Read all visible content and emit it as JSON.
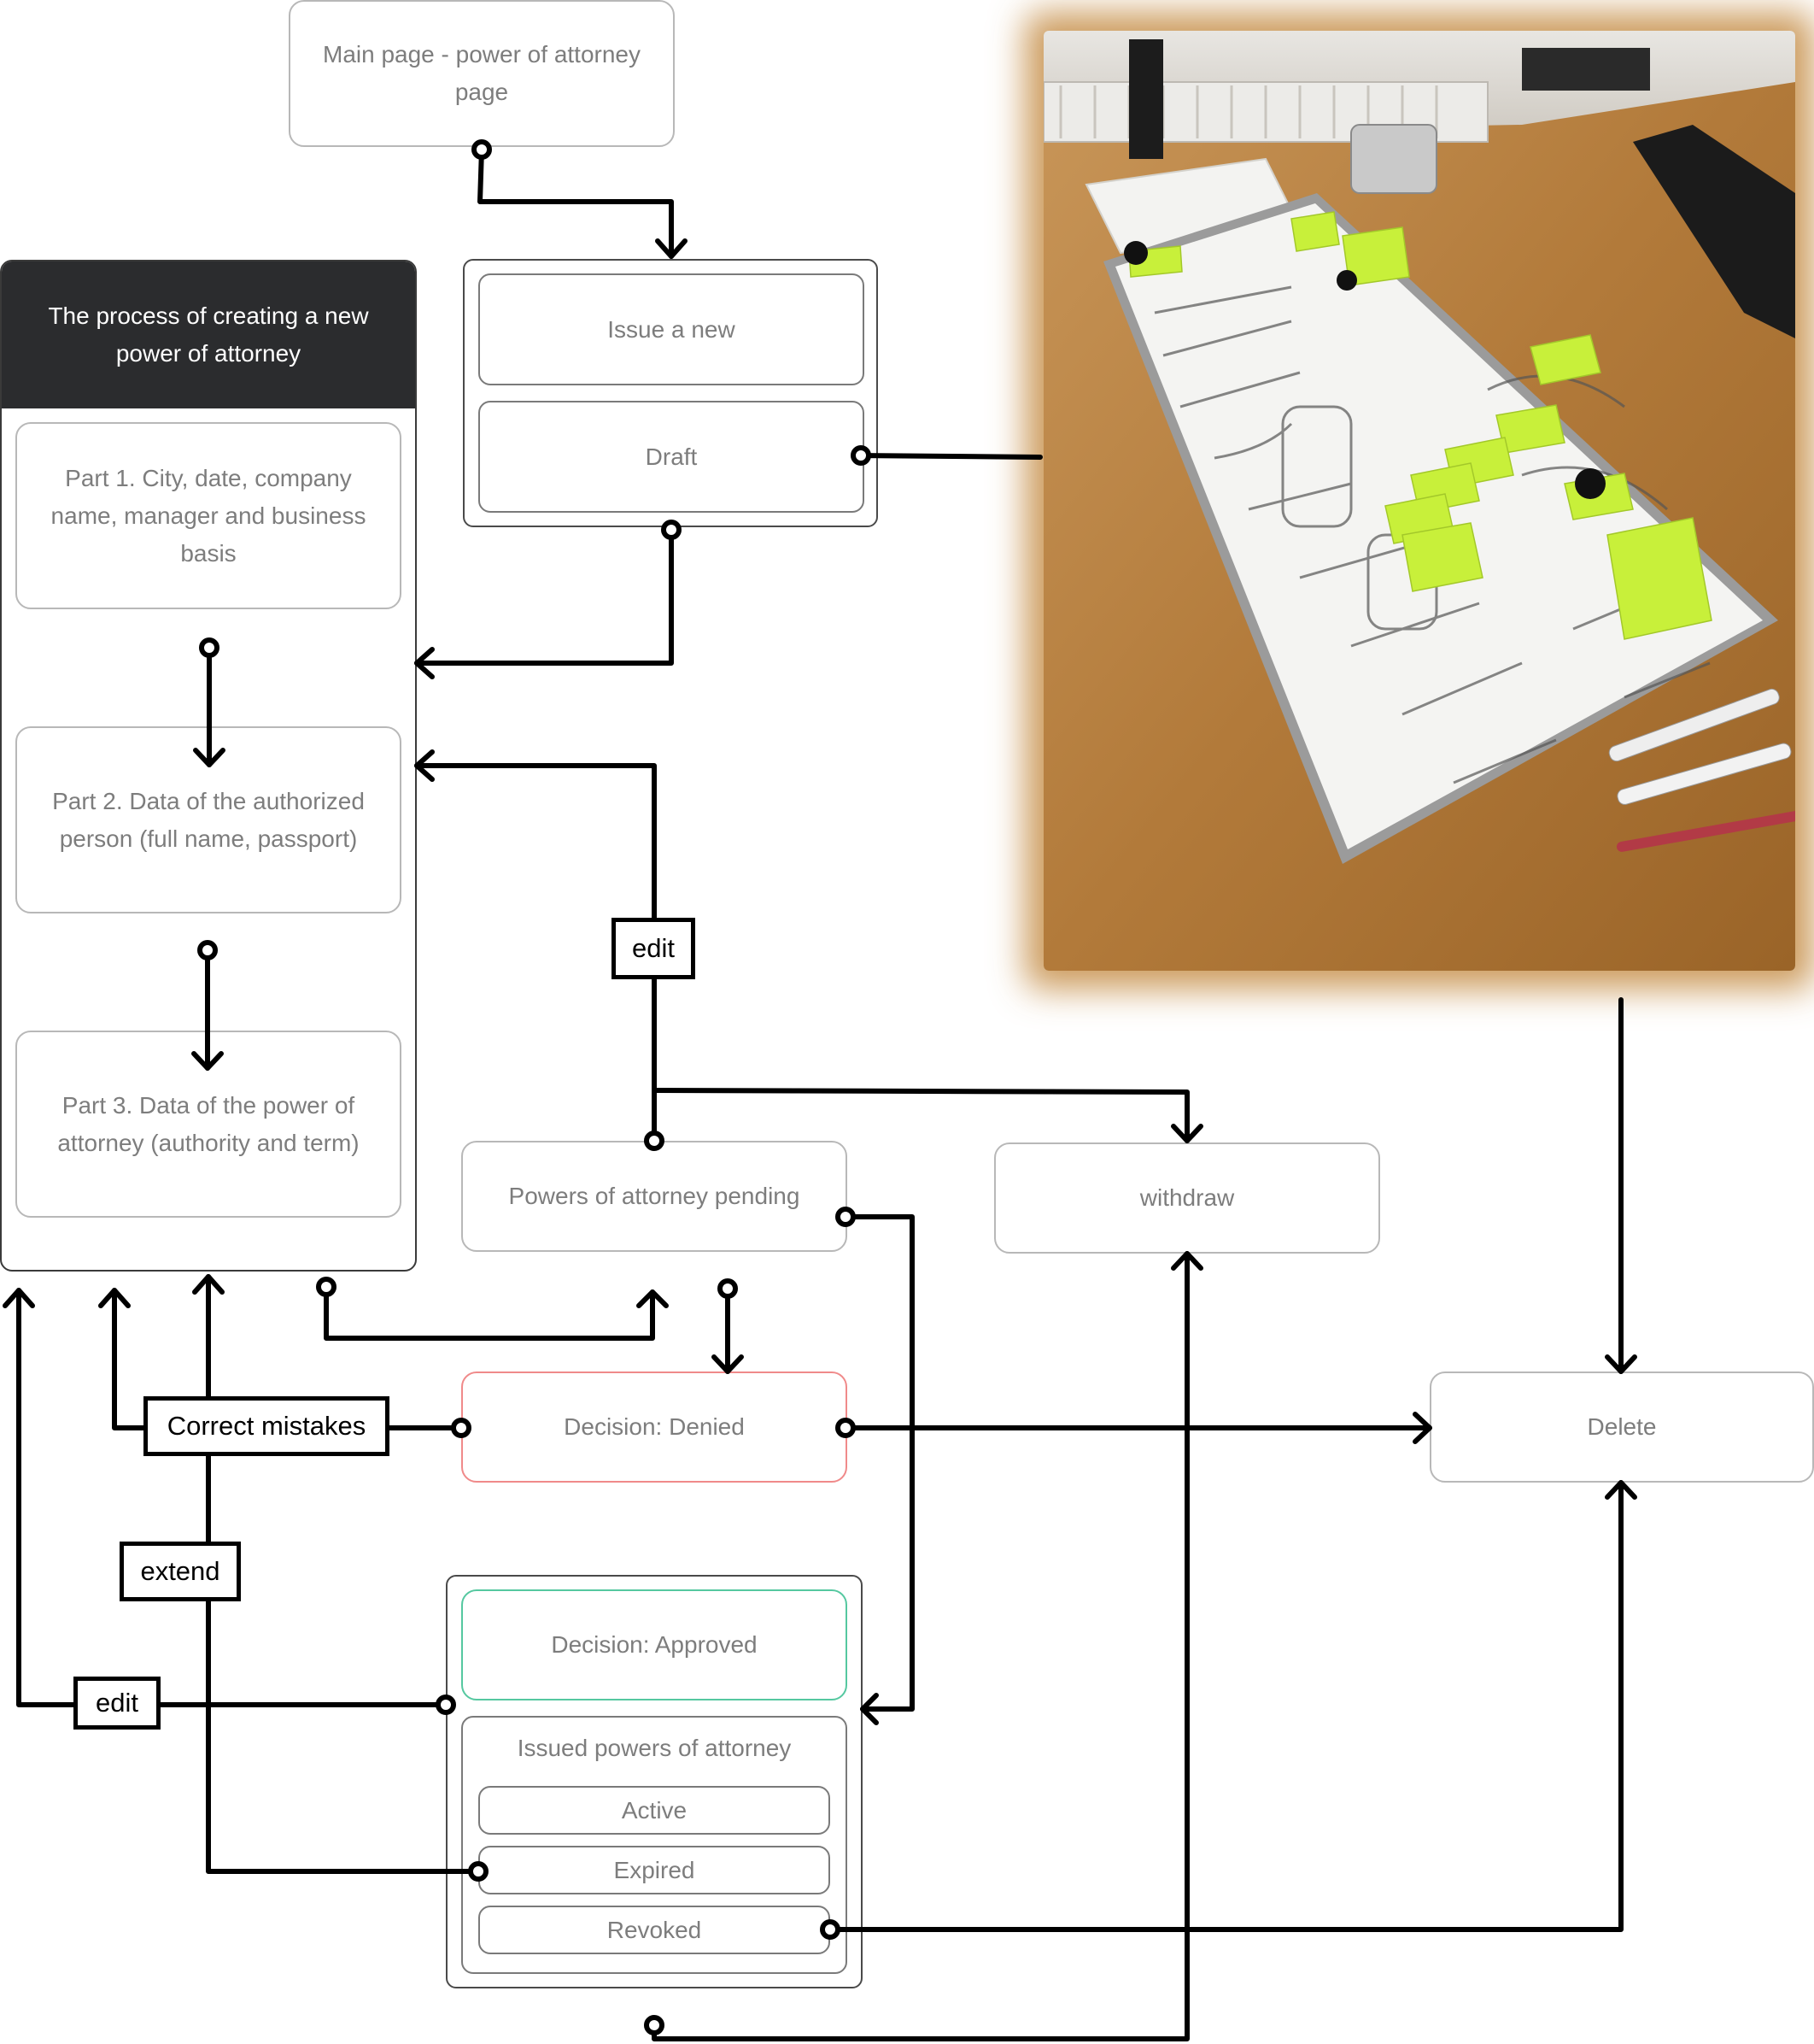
{
  "nodes": {
    "main_page": "Main page - power of attorney page",
    "issue_new": "Issue a new",
    "draft": "Draft",
    "process_title": "The process of creating a new power of attorney",
    "part1": "Part 1. City, date, company name, manager and business basis",
    "part2": "Part 2. Data of the authorized person (full name, passport)",
    "part3": "Part 3. Data of the power of attorney (authority and term)",
    "pending": "Powers of attorney pending",
    "withdraw": "withdraw",
    "denied": "Decision: Denied",
    "delete": "Delete",
    "approved": "Decision: Approved",
    "issued_title": "Issued powers of attorney",
    "issued_items": [
      "Active",
      "Expired",
      "Revoked"
    ]
  },
  "edge_labels": {
    "edit_top": "edit",
    "correct_mistakes": "Correct mistakes",
    "extend": "extend",
    "edit_bottom": "edit"
  },
  "photo": {
    "subject": "whiteboard-sketch-photo",
    "sticky_note_color": "#c8f03a",
    "table_color": "#b8843f",
    "board_color": "#f4f4f2"
  },
  "colors": {
    "denied_border": "#f08a8a",
    "approved_border": "#55c8a0",
    "header_bg": "#2b2c2e",
    "box_border": "#b8b8b8",
    "text": "#7d7d7d"
  }
}
